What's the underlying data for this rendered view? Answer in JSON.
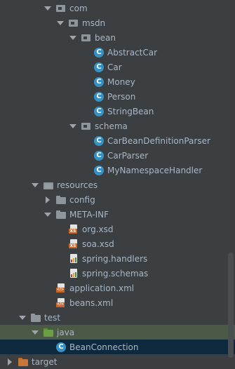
{
  "tree": {
    "com": "com",
    "msdn": "msdn",
    "bean": "bean",
    "abstract_car": "AbstractCar",
    "car": "Car",
    "money": "Money",
    "person": "Person",
    "string_bean": "StringBean",
    "schema": "schema",
    "car_bean_definition_parser": "CarBeanDefinitionParser",
    "car_parser": "CarParser",
    "my_namespace_handler": "MyNamespaceHandler",
    "resources": "resources",
    "config": "config",
    "meta_inf": "META-INF",
    "org_xsd": "org.xsd",
    "soa_xsd": "soa.xsd",
    "spring_handlers": "spring.handlers",
    "spring_schemas": "spring.schemas",
    "application_xml": "application.xml",
    "beans_xml": "beans.xml",
    "test": "test",
    "java": "java",
    "bean_connection": "BeanConnection",
    "target": "target"
  },
  "class_icon_letter": "C",
  "colors": {
    "background": "#3c3f41",
    "text": "#a9b7c6",
    "highlight_row": "#4b5a46",
    "selected_row": "#0d293e",
    "class_icon": "#3592c4"
  }
}
